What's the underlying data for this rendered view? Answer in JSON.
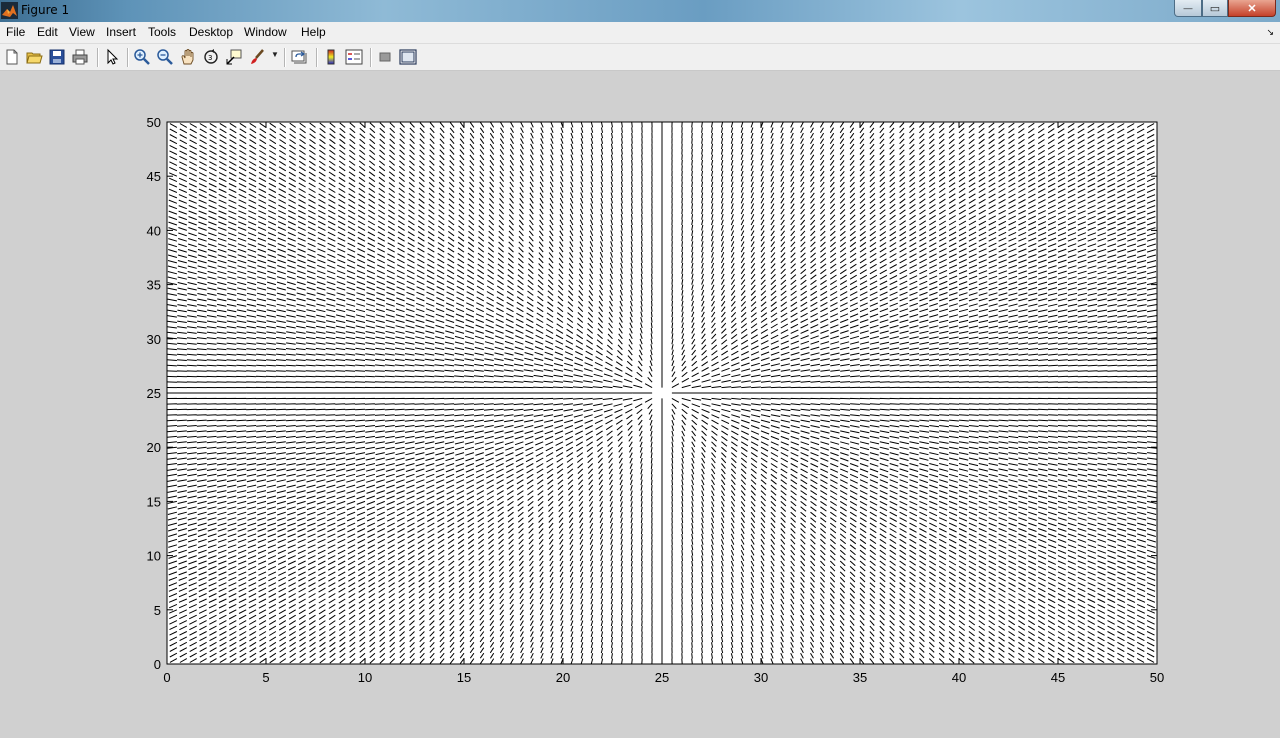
{
  "window": {
    "title": "Figure 1",
    "buttons": {
      "minimize": "—",
      "maximize": "▭",
      "close": "✕"
    }
  },
  "menubar": {
    "items": [
      {
        "label": "File"
      },
      {
        "label": "Edit"
      },
      {
        "label": "View"
      },
      {
        "label": "Insert"
      },
      {
        "label": "Tools"
      },
      {
        "label": "Desktop"
      },
      {
        "label": "Window"
      },
      {
        "label": "Help"
      }
    ],
    "dock_glyph": "↘"
  },
  "toolbar": {
    "buttons": [
      {
        "icon": "new-figure-icon"
      },
      {
        "icon": "open-file-icon"
      },
      {
        "icon": "save-icon"
      },
      {
        "icon": "print-icon"
      },
      {
        "icon": "edit-plot-arrow-icon"
      },
      {
        "icon": "zoom-in-icon"
      },
      {
        "icon": "zoom-out-icon"
      },
      {
        "icon": "pan-hand-icon"
      },
      {
        "icon": "rotate-3d-icon"
      },
      {
        "icon": "data-cursor-icon"
      },
      {
        "icon": "brush-icon"
      },
      {
        "icon": "link-plot-icon"
      },
      {
        "icon": "insert-colorbar-icon"
      },
      {
        "icon": "insert-legend-icon"
      },
      {
        "icon": "hide-plot-tools-icon"
      },
      {
        "icon": "show-plot-tools-icon"
      }
    ]
  },
  "colors": {
    "figure_background": "#d0d0d0",
    "axes_background": "#ffffff",
    "lines": "#000000"
  },
  "chart_data": {
    "type": "quiver",
    "title": "",
    "xlabel": "",
    "ylabel": "",
    "xlim": [
      0,
      50
    ],
    "ylim": [
      0,
      50
    ],
    "xticks": [
      0,
      5,
      10,
      15,
      20,
      25,
      30,
      35,
      40,
      45,
      50
    ],
    "yticks": [
      0,
      5,
      10,
      15,
      20,
      25,
      30,
      35,
      40,
      45,
      50
    ],
    "xtick_labels": [
      "0",
      "5",
      "10",
      "15",
      "20",
      "25",
      "30",
      "35",
      "40",
      "45",
      "50"
    ],
    "ytick_labels": [
      "0",
      "5",
      "10",
      "15",
      "20",
      "25",
      "30",
      "35",
      "40",
      "45",
      "50"
    ],
    "grid": false,
    "grid_points": {
      "x": [
        0.5,
        49.5
      ],
      "y": [
        0.5,
        49.5
      ],
      "step": 0.5
    },
    "field_center": [
      25,
      25
    ],
    "arrow_length": 0.5
  }
}
